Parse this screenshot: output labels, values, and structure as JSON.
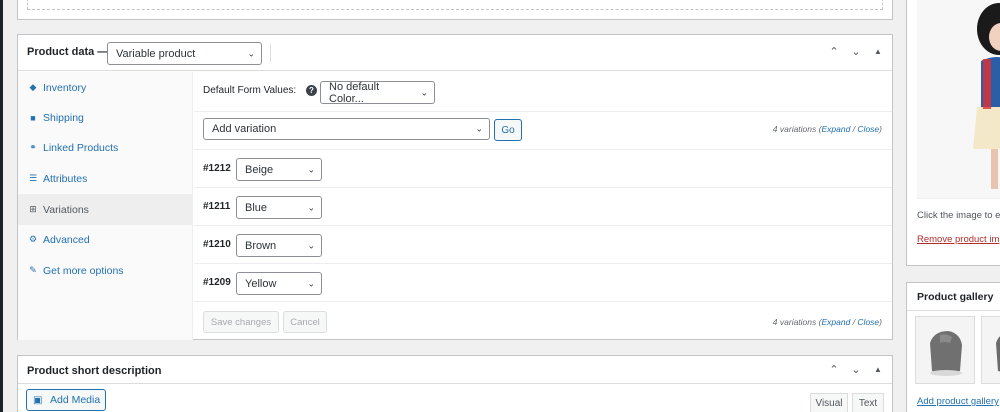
{
  "product_data": {
    "title": "Product data —",
    "product_type": "Variable product",
    "controls": {
      "up": "⌃",
      "down": "⌄",
      "toggle": "▲"
    }
  },
  "tabs": [
    {
      "label": "Inventory",
      "icon": "tag-icon",
      "glyph": "◆"
    },
    {
      "label": "Shipping",
      "icon": "truck-icon",
      "glyph": "■"
    },
    {
      "label": "Linked Products",
      "icon": "link-icon",
      "glyph": "⚭"
    },
    {
      "label": "Attributes",
      "icon": "list-icon",
      "glyph": "☰"
    },
    {
      "label": "Variations",
      "icon": "grid-icon",
      "glyph": "⊞"
    },
    {
      "label": "Advanced",
      "icon": "gear-icon",
      "glyph": "⚙"
    },
    {
      "label": "Get more options",
      "icon": "plugin-icon",
      "glyph": "✎"
    }
  ],
  "variations_panel": {
    "default_form_values_label": "Default Form Values:",
    "help_glyph": "?",
    "default_color_select": "No default Color...",
    "add_variation_select": "Add variation",
    "go_button": "Go",
    "count_text": "4 variations",
    "expand_label": "Expand",
    "separator": " / ",
    "close_label": "Close",
    "open_paren": "(",
    "close_paren": ")",
    "variations": [
      {
        "id": "#1212",
        "color": "Beige"
      },
      {
        "id": "#1211",
        "color": "Blue"
      },
      {
        "id": "#1210",
        "color": "Brown"
      },
      {
        "id": "#1209",
        "color": "Yellow"
      }
    ],
    "save_button": "Save changes",
    "cancel_button": "Cancel"
  },
  "short_description": {
    "title": "Product short description",
    "add_media": "Add Media",
    "visual_tab": "Visual",
    "text_tab": "Text"
  },
  "sidebar": {
    "click_text": "Click the image to e",
    "remove_link": "Remove product im",
    "gallery_title": "Product gallery",
    "gallery_link": "Add product gallery"
  }
}
